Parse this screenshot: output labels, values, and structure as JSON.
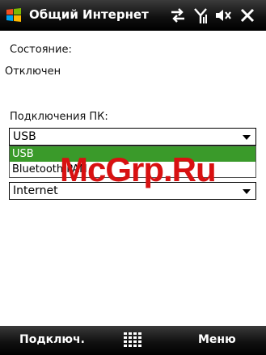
{
  "titlebar": {
    "title": "Общий Интернет",
    "icons": [
      "windows-start-icon",
      "sync-arrows-icon",
      "signal-icon",
      "speaker-mute-icon",
      "close-icon"
    ]
  },
  "content": {
    "status_label": "Состояние:",
    "status_value": "Отключен",
    "pc_connection_label": "Подключения ПК:",
    "pc_connection_value": "USB",
    "pc_connection_options": [
      "USB",
      "Bluetooth PAN"
    ],
    "network_value": "Internet"
  },
  "watermark": "McGrp.Ru",
  "menubar": {
    "left_softkey": "Подключ.",
    "right_softkey": "Меню"
  },
  "colors": {
    "selection": "#3a9a2a",
    "watermark": "#d81111",
    "bar": "#000000"
  }
}
